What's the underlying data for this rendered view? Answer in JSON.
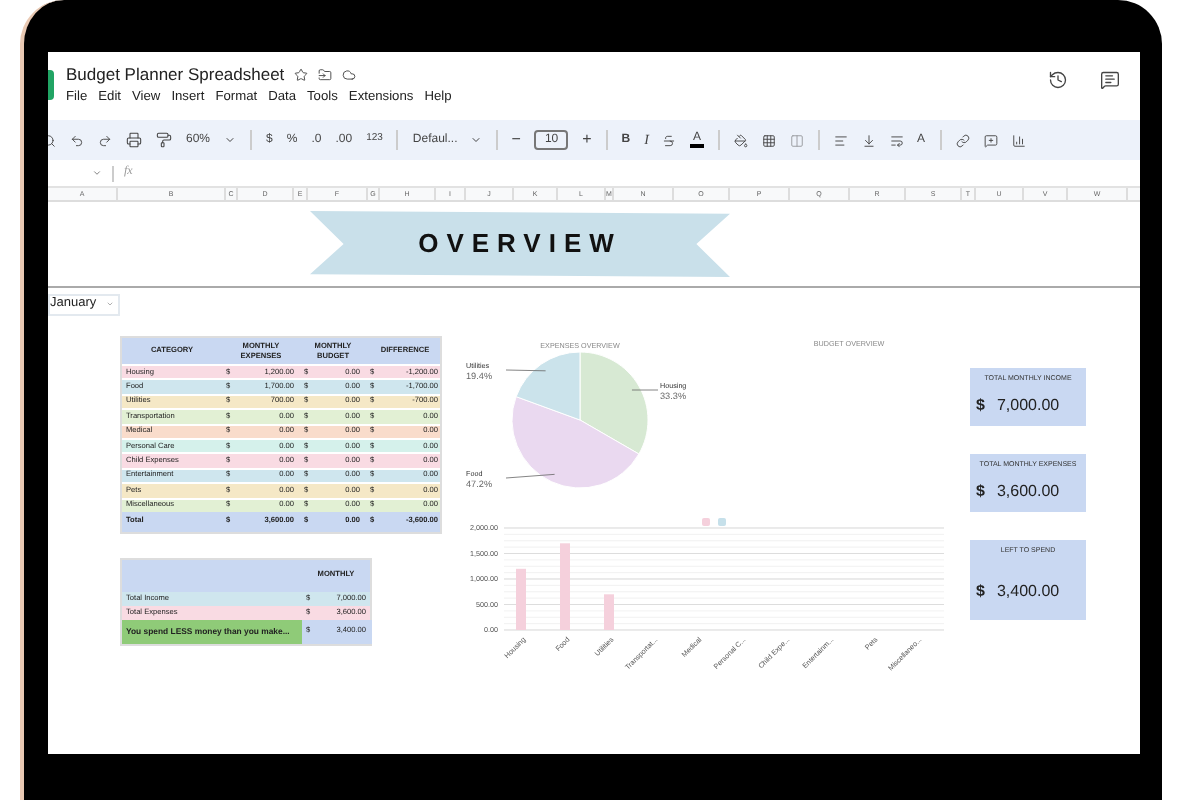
{
  "document": {
    "title": "Budget Planner Spreadsheet"
  },
  "menu": [
    "File",
    "Edit",
    "View",
    "Insert",
    "Format",
    "Data",
    "Tools",
    "Extensions",
    "Help"
  ],
  "toolbar": {
    "zoom": "60%",
    "currency": "$",
    "percent": "%",
    "decimals_less": ".0",
    "decimals_more": ".00",
    "number_format": "123",
    "font": "Defaul...",
    "size_minus": "−",
    "font_size": "10",
    "size_plus": "+",
    "bold": "B",
    "italic": "I",
    "text_color": "A",
    "text_rotation": "A"
  },
  "formula_bar": {
    "label": "fx"
  },
  "columns": [
    "A",
    "B",
    "C",
    "D",
    "E",
    "F",
    "G",
    "H",
    "I",
    "J",
    "K",
    "L",
    "M",
    "N",
    "O",
    "P",
    "Q",
    "R",
    "S",
    "T",
    "U",
    "V",
    "W"
  ],
  "banner": "OVERVIEW",
  "month_select": {
    "value": "January"
  },
  "expense_table": {
    "columns": [
      "CATEGORY",
      "MONTHLY EXPENSES",
      "MONTHLY BUDGET",
      "DIFFERENCE"
    ],
    "rows": [
      {
        "color": "#f9dbe3",
        "cells": [
          "Housing",
          "$",
          "1,200.00",
          "$",
          "0.00",
          "$",
          "-1,200.00"
        ]
      },
      {
        "color": "#cfe6ee",
        "cells": [
          "Food",
          "$",
          "1,700.00",
          "$",
          "0.00",
          "$",
          "-1,700.00"
        ]
      },
      {
        "color": "#f5e8c6",
        "cells": [
          "Utilities",
          "$",
          "700.00",
          "$",
          "0.00",
          "$",
          "-700.00"
        ]
      },
      {
        "color": "#e2f0d4",
        "cells": [
          "Transportation",
          "$",
          "0.00",
          "$",
          "0.00",
          "$",
          "0.00"
        ]
      },
      {
        "color": "#f9dccb",
        "cells": [
          "Medical",
          "$",
          "0.00",
          "$",
          "0.00",
          "$",
          "0.00"
        ]
      },
      {
        "color": "#d5f1eb",
        "cells": [
          "Personal Care",
          "$",
          "0.00",
          "$",
          "0.00",
          "$",
          "0.00"
        ]
      },
      {
        "color": "#f9dbe3",
        "cells": [
          "Child Expenses",
          "$",
          "0.00",
          "$",
          "0.00",
          "$",
          "0.00"
        ]
      },
      {
        "color": "#cfe6ee",
        "cells": [
          "Entertainment",
          "$",
          "0.00",
          "$",
          "0.00",
          "$",
          "0.00"
        ]
      },
      {
        "color": "#f5e8c6",
        "cells": [
          "Pets",
          "$",
          "0.00",
          "$",
          "0.00",
          "$",
          "0.00"
        ]
      },
      {
        "color": "#e2f0d4",
        "cells": [
          "Miscellaneous",
          "$",
          "0.00",
          "$",
          "0.00",
          "$",
          "0.00"
        ]
      }
    ],
    "total": {
      "cells": [
        "Total",
        "$",
        "3,600.00",
        "$",
        "0.00",
        "$",
        "-3,600.00"
      ]
    }
  },
  "summary_table": {
    "header": "MONTHLY",
    "rows": [
      {
        "kind": "line",
        "color": "#cfe6ee",
        "cells": [
          "Total Income",
          "$",
          "7,000.00"
        ]
      },
      {
        "kind": "line",
        "color": "#f9dbe3",
        "cells": [
          "Total Expenses",
          "$",
          "3,600.00"
        ]
      },
      {
        "kind": "result",
        "color": "#8fcb78",
        "cells": [
          "You spend LESS money than you make...",
          "$",
          "3,400.00"
        ]
      }
    ]
  },
  "expenses_chart": {
    "chart_data": {
      "type": "pie",
      "title": "EXPENSES OVERVIEW",
      "categories": [
        "Housing",
        "Food",
        "Utilities"
      ],
      "values": [
        33.3,
        47.2,
        19.4
      ],
      "value_labels": [
        "33.3%",
        "47.2%",
        "19.4%"
      ]
    }
  },
  "budget_chart": {
    "title": "BUDGET OVERVIEW"
  },
  "bar_chart": {
    "chart_data": {
      "type": "bar",
      "categories": [
        "Housing",
        "Food",
        "Utilities",
        "Transportat...",
        "Medical",
        "Personal C...",
        "Child Expe...",
        "Entertainm...",
        "Pets",
        "Miscellaneo..."
      ],
      "series": [
        {
          "color": "#f5d0dc",
          "values": [
            1200,
            1700,
            700,
            0,
            0,
            0,
            0,
            0,
            0,
            0
          ]
        },
        {
          "color": "#c6e0ea",
          "values": [
            0,
            0,
            0,
            0,
            0,
            0,
            0,
            0,
            0,
            0
          ]
        }
      ],
      "ylim": [
        0,
        2000
      ],
      "grid": true,
      "yticks": [
        {
          "value": 0,
          "label": "0.00"
        },
        {
          "value": 500,
          "label": "500.00"
        },
        {
          "value": 1000,
          "label": "1,000.00"
        },
        {
          "value": 1500,
          "label": "1,500.00"
        },
        {
          "value": 2000,
          "label": "2,000.00"
        }
      ]
    }
  },
  "cards": [
    {
      "title": "TOTAL MONTHLY INCOME",
      "currency": "$",
      "amount": "7,000.00"
    },
    {
      "title": "TOTAL MONTHLY EXPENSES",
      "currency": "$",
      "amount": "3,600.00"
    },
    {
      "title": "LEFT TO SPEND",
      "currency": "$",
      "amount": "3,400.00"
    }
  ]
}
